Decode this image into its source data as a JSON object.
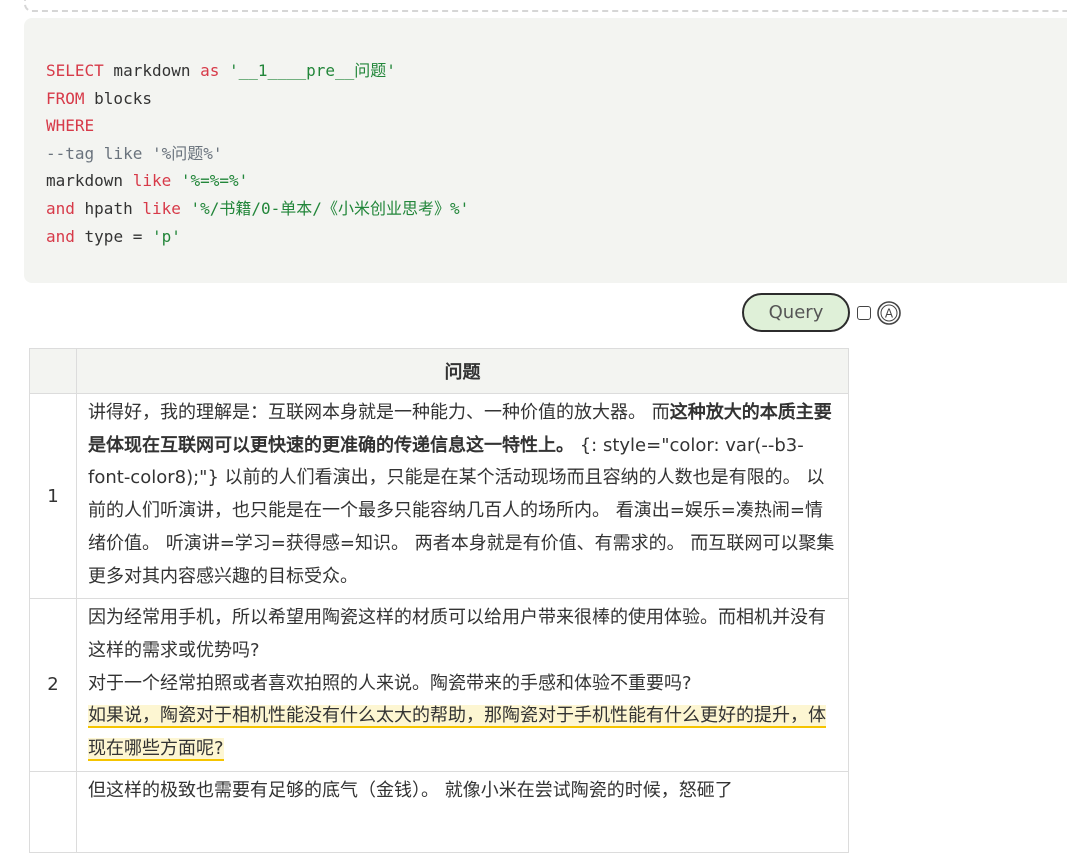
{
  "code": {
    "line1_kw": "SELECT",
    "line1_mid": " markdown ",
    "line1_as": "as",
    "line1_str": " '__1____pre__问题'",
    "line2_kw": "FROM",
    "line2_rest": " blocks",
    "line3_kw": "WHERE",
    "line4_comment": "--tag like '%问题%'",
    "line5_a": "markdown ",
    "line5_kw": "like",
    "line5_str": " '%=%=%'",
    "line6_kw1": "and",
    "line6_a": " hpath ",
    "line6_kw2": "like",
    "line6_str": " '%/书籍/0-单本/《小米创业思考》%'",
    "line7_kw": "and",
    "line7_a": " type = ",
    "line7_str": "'p'"
  },
  "toolbar": {
    "query_label": "Query",
    "auto_icon": "circle-a-icon"
  },
  "table": {
    "header": "问题",
    "rows": [
      {
        "index": "1",
        "t1": "讲得好，我的理解是：互联网本身就是一种能力、一种价值的放大器。 而",
        "b1": "这种放大的本质主要是体现在互联网可以更快速的更准确的传递信息这一特性上。",
        "t2": " {: style=\"color: var(--b3-font-color8);\"}  以前的人们看演出，只能是在某个活动现场而且容纳的人数也是有限的。 以前的人们听演讲，也只能是在一个最多只能容纳几百人的场所内。 看演出=娱乐=凑热闹=情绪价值。 听演讲=学习=获得感=知识。 两者本身就是有价值、有需求的。 而互联网可以聚集更多对其内容感兴趣的目标受众。"
      },
      {
        "index": "2",
        "l1": "因为经常用手机，所以希望用陶瓷这样的材质可以给用户带来很棒的使用体验。而相机并没有这样的需求或优势吗?",
        "l2": "对于一个经常拍照或者喜欢拍照的人来说。陶瓷带来的手感和体验不重要吗?",
        "hl": "如果说，陶瓷对于相机性能没有什么太大的帮助，那陶瓷对于手机性能有什么更好的提升，体现在哪些方面呢?"
      },
      {
        "index": "",
        "l1": "但这样的极致也需要有足够的底气（金钱）。 就像小米在尝试陶瓷的时候，怒砸了"
      }
    ]
  }
}
